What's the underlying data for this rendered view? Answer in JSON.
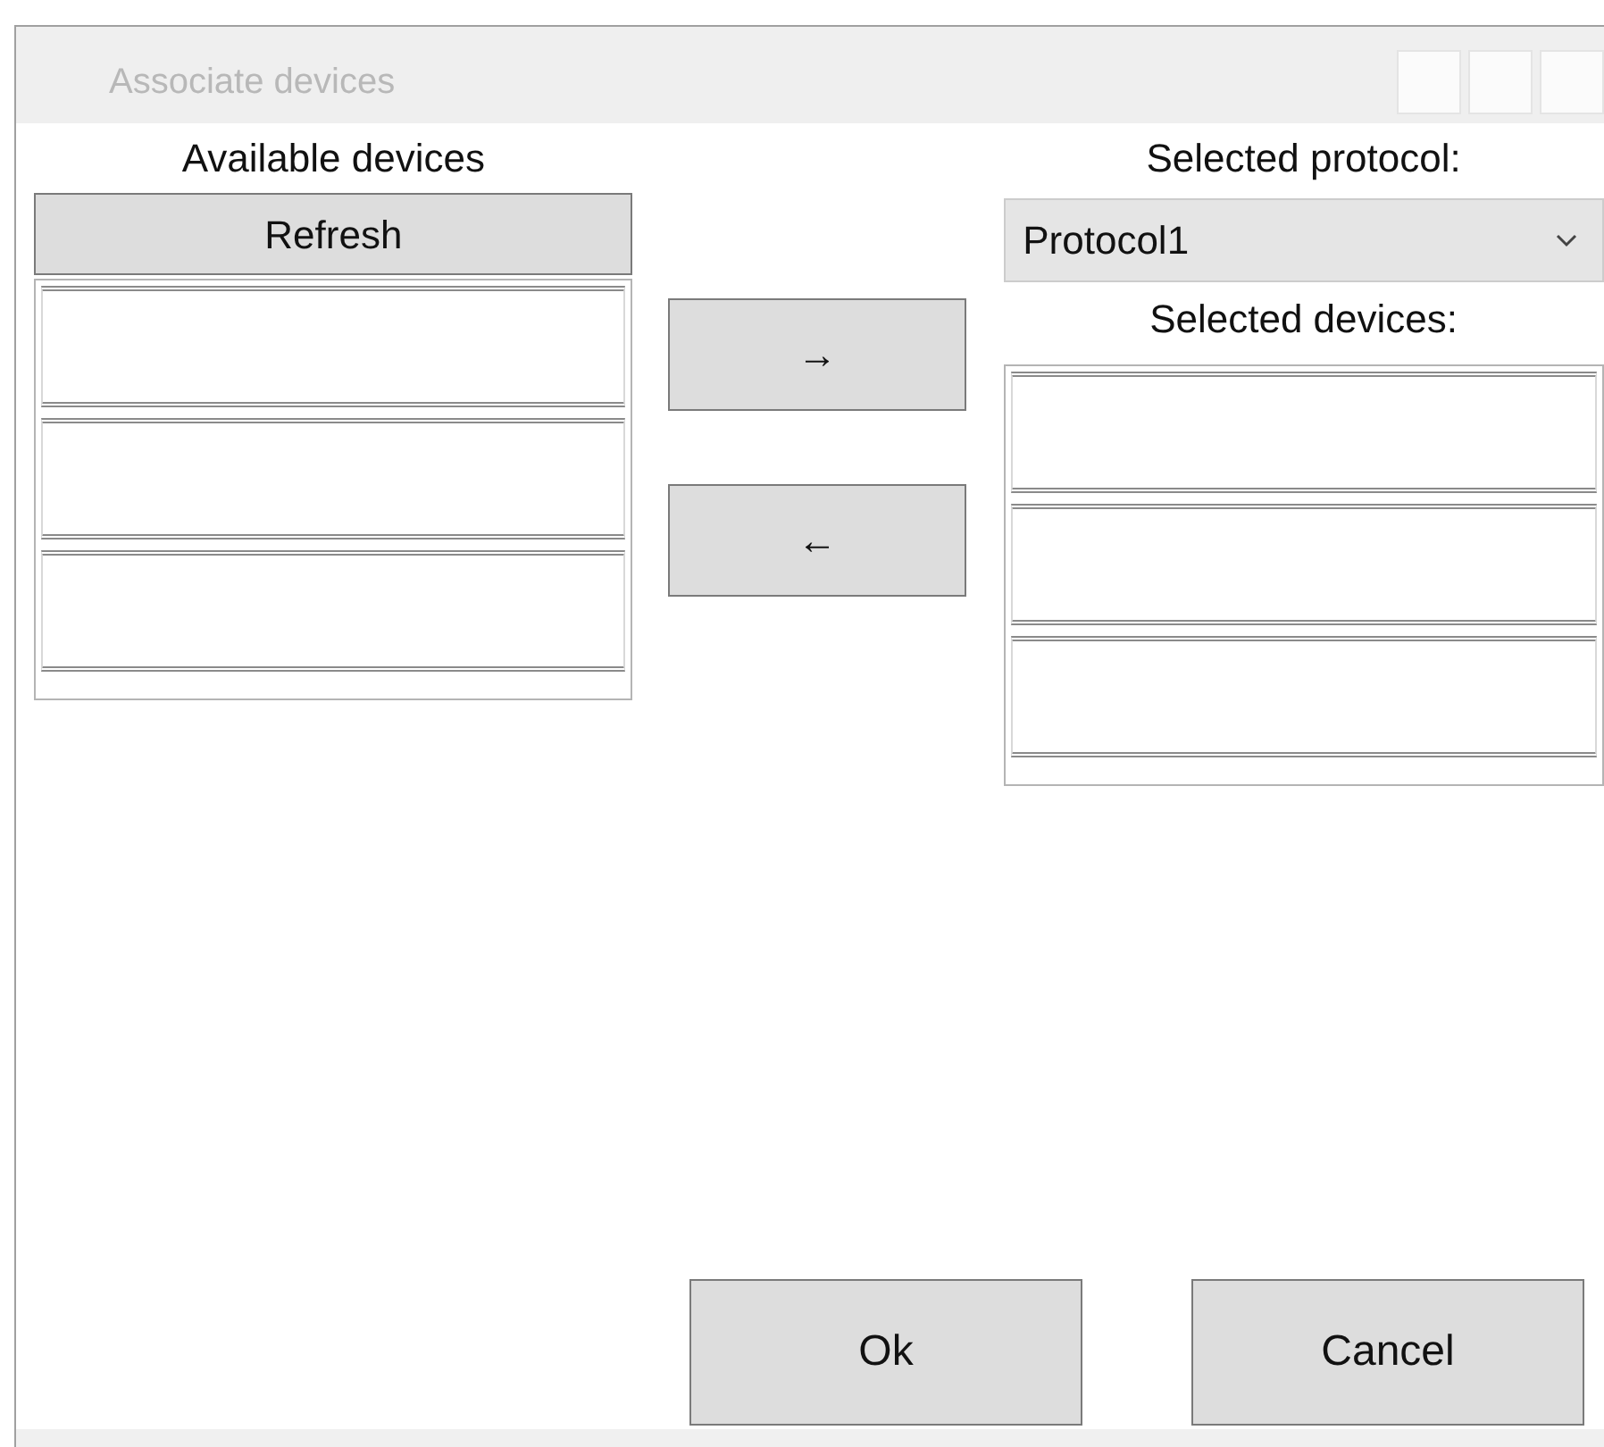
{
  "window": {
    "title": "Associate devices"
  },
  "available_devices": {
    "label": "Available devices",
    "refresh_button": "Refresh"
  },
  "move_buttons": [
    "→",
    "←"
  ],
  "protocol": {
    "label": "Selected protocol:",
    "value": "Protocol1"
  },
  "selected_devices": {
    "label": "Selected devices:"
  },
  "buttons": [
    "Ok",
    "Cancel"
  ]
}
